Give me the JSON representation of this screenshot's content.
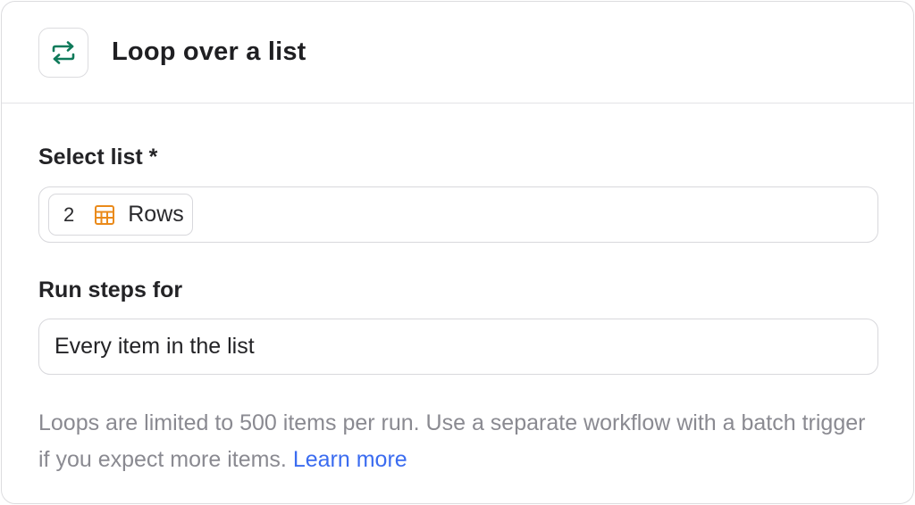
{
  "header": {
    "title": "Loop over a list",
    "icon": "loop-arrows-icon",
    "icon_color": "#0f7a5a"
  },
  "select_list": {
    "label": "Select list *",
    "chip": {
      "count": "2",
      "icon": "table-grid-icon",
      "icon_color": "#ea8a1a",
      "label": "Rows"
    }
  },
  "run_steps": {
    "label": "Run steps for",
    "value": "Every item in the list"
  },
  "helper": {
    "text": "Loops are limited to 500 items per run. Use a separate workflow with a batch trigger if you expect more items.",
    "link_label": "Learn more",
    "link_color": "#3b6cf0"
  }
}
